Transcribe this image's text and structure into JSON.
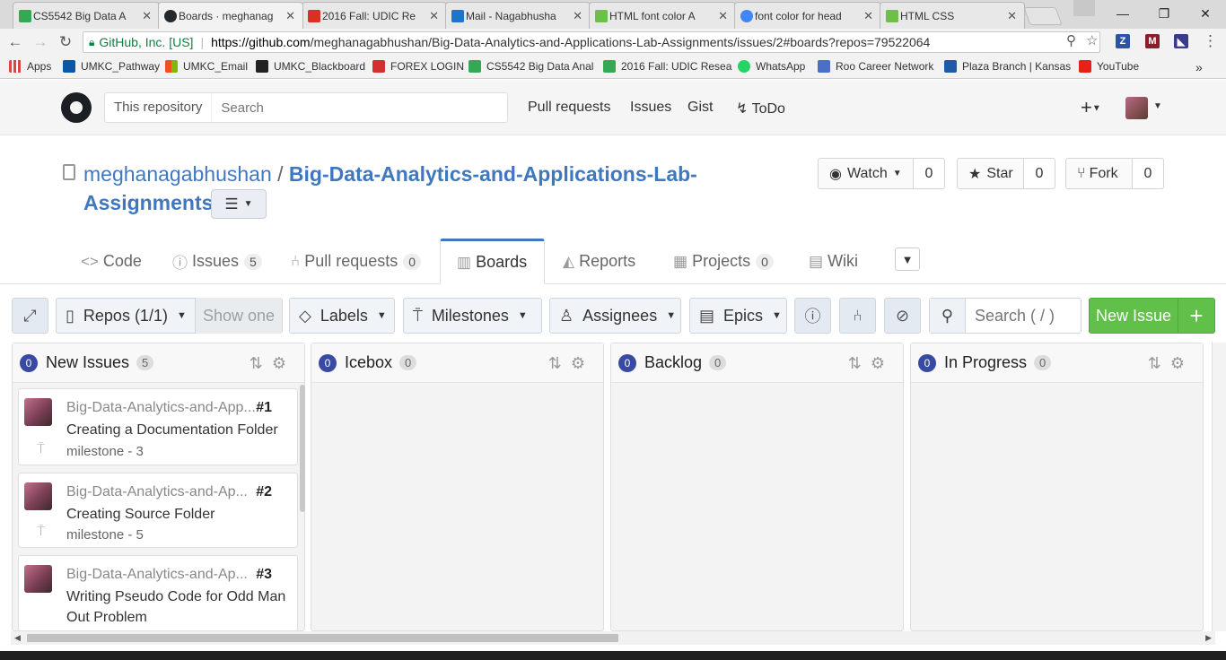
{
  "browser": {
    "tabs": [
      {
        "title": "CS5542 Big Data A",
        "favicon_color": "#34a853"
      },
      {
        "title": "Boards · meghanag",
        "favicon_color": "#24292e"
      },
      {
        "title": "2016 Fall: UDIC Re",
        "favicon_color": "#d93025"
      },
      {
        "title": "Mail - Nagabhusha",
        "favicon_color": "#1e74c9"
      },
      {
        "title": "HTML font color A",
        "favicon_color": "#6cc04a"
      },
      {
        "title": "font color for head",
        "favicon_color": "#4285f4"
      },
      {
        "title": "HTML CSS",
        "favicon_color": "#6cc04a"
      }
    ],
    "secure_org": "GitHub, Inc. [US]",
    "url_prefix": "https://github.com",
    "url_path": "/meghanagabhushan/Big-Data-Analytics-and-Applications-Lab-Assignments/issues/2#boards?repos=79522064",
    "bookmarks": [
      {
        "label": "Apps",
        "color": "#d44"
      },
      {
        "label": "UMKC_Pathway",
        "color": "#0a56a7"
      },
      {
        "label": "UMKC_Email",
        "color": "#f25022"
      },
      {
        "label": "UMKC_Blackboard",
        "color": "#222"
      },
      {
        "label": "FOREX LOGIN",
        "color": "#d32f2f"
      },
      {
        "label": "CS5542 Big Data Anal",
        "color": "#34a853"
      },
      {
        "label": "2016 Fall: UDIC Resea",
        "color": "#34a853"
      },
      {
        "label": "WhatsApp",
        "color": "#25d366"
      },
      {
        "label": "Roo Career Network",
        "color": "#4a6fc4"
      },
      {
        "label": "Plaza Branch | Kansas",
        "color": "#1e5aa8"
      },
      {
        "label": "YouTube",
        "color": "#e62117"
      }
    ]
  },
  "github": {
    "search_scope": "This repository",
    "search_placeholder": "Search",
    "nav": [
      "Pull requests",
      "Issues",
      "Gist",
      "ToDo"
    ],
    "repo_owner": "meghanagabhushan",
    "repo_name_1": "Big-Data-Analytics-and-Applications-Lab-",
    "repo_name_2": "Assignments",
    "watch_label": "Watch",
    "watch_count": "0",
    "star_label": "Star",
    "star_count": "0",
    "fork_label": "Fork",
    "fork_count": "0",
    "tabs": {
      "code": "Code",
      "issues": "Issues",
      "issues_count": "5",
      "pulls": "Pull requests",
      "pulls_count": "0",
      "boards": "Boards",
      "reports": "Reports",
      "projects": "Projects",
      "projects_count": "0",
      "wiki": "Wiki"
    }
  },
  "board": {
    "toolbar": {
      "repos": "Repos (1/1)",
      "show_one": "Show one",
      "labels": "Labels",
      "milestones": "Milestones",
      "assignees": "Assignees",
      "epics": "Epics",
      "search_placeholder": "Search ( / )",
      "new_issue": "New Issue"
    },
    "columns": [
      {
        "num": "0",
        "name": "New Issues",
        "count": "5"
      },
      {
        "num": "0",
        "name": "Icebox",
        "count": "0"
      },
      {
        "num": "0",
        "name": "Backlog",
        "count": "0"
      },
      {
        "num": "0",
        "name": "In Progress",
        "count": "0"
      }
    ],
    "cards": [
      {
        "repo": "Big-Data-Analytics-and-App...",
        "number": "#1",
        "title": "Creating a Documentation Folder",
        "milestone": "milestone - 3"
      },
      {
        "repo": "Big-Data-Analytics-and-Ap...",
        "number": "#2",
        "title": "Creating Source Folder",
        "milestone": "milestone - 5"
      },
      {
        "repo": "Big-Data-Analytics-and-Ap...",
        "number": "#3",
        "title": "Writing Pseudo Code for Odd Man Out Problem",
        "milestone": ""
      }
    ]
  }
}
